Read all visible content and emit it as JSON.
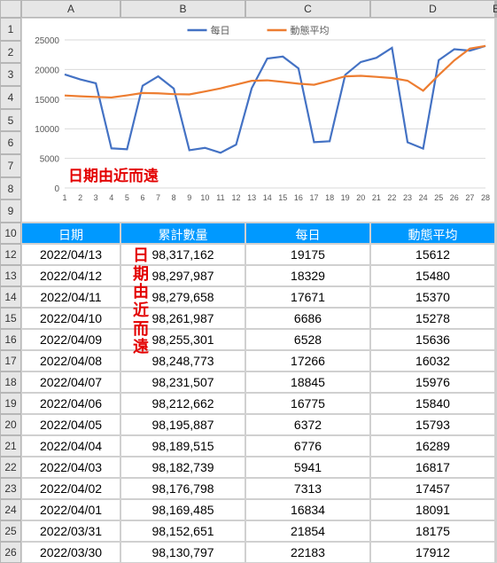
{
  "columns": [
    "A",
    "B",
    "C",
    "D",
    "E"
  ],
  "chart_row_nums": [
    1,
    2,
    3,
    4,
    5,
    6,
    7,
    8,
    9
  ],
  "header_row_num": 10,
  "data_row_nums": [
    12,
    13,
    14,
    15,
    16,
    17,
    18,
    19,
    20,
    21,
    22,
    23,
    24,
    25,
    26
  ],
  "headers": {
    "c0": "日期",
    "c1": "累計數量",
    "c2": "每日",
    "c3": "動態平均"
  },
  "rows": [
    {
      "date": "2022/04/13",
      "cum": "98,317,162",
      "daily": "19175",
      "avg": "15612"
    },
    {
      "date": "2022/04/12",
      "cum": "98,297,987",
      "daily": "18329",
      "avg": "15480"
    },
    {
      "date": "2022/04/11",
      "cum": "98,279,658",
      "daily": "17671",
      "avg": "15370"
    },
    {
      "date": "2022/04/10",
      "cum": "98,261,987",
      "daily": "6686",
      "avg": "15278"
    },
    {
      "date": "2022/04/09",
      "cum": "98,255,301",
      "daily": "6528",
      "avg": "15636"
    },
    {
      "date": "2022/04/08",
      "cum": "98,248,773",
      "daily": "17266",
      "avg": "16032"
    },
    {
      "date": "2022/04/07",
      "cum": "98,231,507",
      "daily": "18845",
      "avg": "15976"
    },
    {
      "date": "2022/04/06",
      "cum": "98,212,662",
      "daily": "16775",
      "avg": "15840"
    },
    {
      "date": "2022/04/05",
      "cum": "98,195,887",
      "daily": "6372",
      "avg": "15793"
    },
    {
      "date": "2022/04/04",
      "cum": "98,189,515",
      "daily": "6776",
      "avg": "16289"
    },
    {
      "date": "2022/04/03",
      "cum": "98,182,739",
      "daily": "5941",
      "avg": "16817"
    },
    {
      "date": "2022/04/02",
      "cum": "98,176,798",
      "daily": "7313",
      "avg": "17457"
    },
    {
      "date": "2022/04/01",
      "cum": "98,169,485",
      "daily": "16834",
      "avg": "18091"
    },
    {
      "date": "2022/03/31",
      "cum": "98,152,651",
      "daily": "21854",
      "avg": "18175"
    },
    {
      "date": "2022/03/30",
      "cum": "98,130,797",
      "daily": "22183",
      "avg": "17912"
    }
  ],
  "red_label_horizontal": "日期由近而遠",
  "red_label_vertical": "日期由近而遠",
  "chart_data": {
    "type": "line",
    "title": "",
    "xlabel": "",
    "ylabel": "",
    "ylim": [
      0,
      25000
    ],
    "yticks": [
      0,
      5000,
      10000,
      15000,
      20000,
      25000
    ],
    "x": [
      1,
      2,
      3,
      4,
      5,
      6,
      7,
      8,
      9,
      10,
      11,
      12,
      13,
      14,
      15,
      16,
      17,
      18,
      19,
      20,
      21,
      22,
      23,
      24,
      25,
      26,
      27,
      28
    ],
    "series": [
      {
        "name": "每日",
        "color": "#4472c4",
        "values": [
          19175,
          18329,
          17671,
          6686,
          6528,
          17266,
          18845,
          16775,
          6372,
          6776,
          5941,
          7313,
          16834,
          21854,
          22183,
          20186,
          7741,
          7887,
          19095,
          21264,
          21976,
          23655,
          7710,
          6647,
          21570,
          23428,
          23184,
          23985
        ]
      },
      {
        "name": "動態平均",
        "color": "#ed7d31",
        "values": [
          15612,
          15480,
          15370,
          15278,
          15636,
          16032,
          15976,
          15840,
          15793,
          16289,
          16817,
          17457,
          18091,
          18175,
          17912,
          17607,
          17422,
          18110,
          18847,
          18934,
          18763,
          18562,
          18116,
          16422,
          19056,
          21542,
          23532,
          23985
        ]
      }
    ],
    "legend_position": "top",
    "grid": true
  }
}
